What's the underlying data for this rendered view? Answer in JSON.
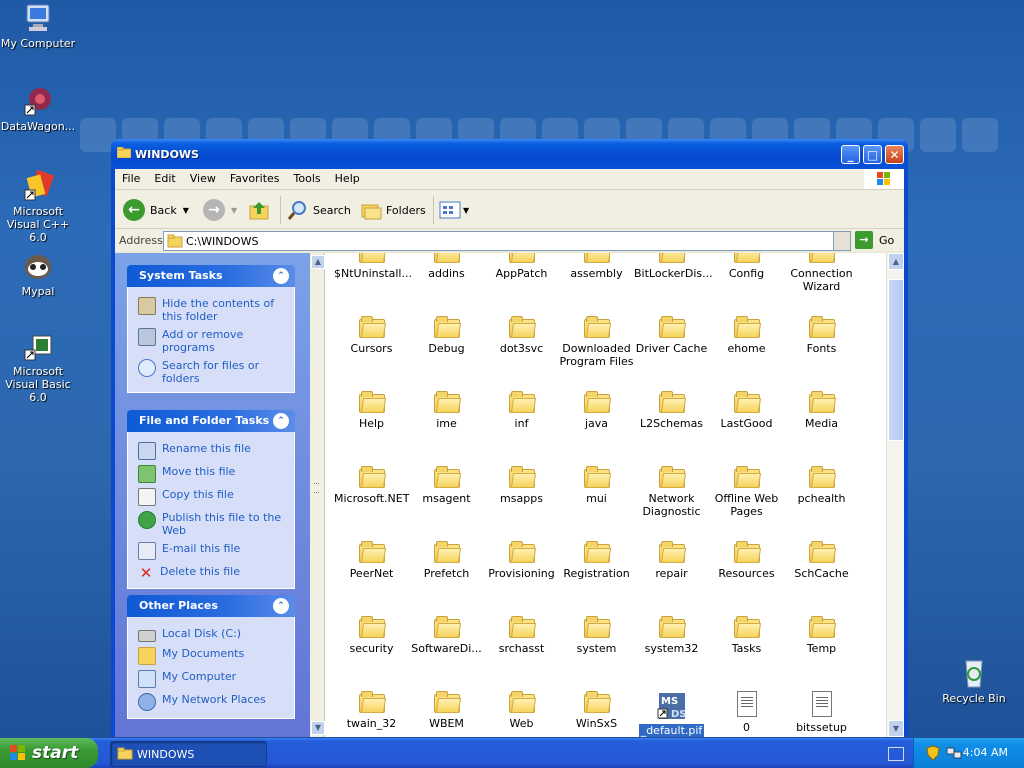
{
  "desktop": {
    "icons": [
      {
        "label": "My Computer",
        "icon": "my-computer-icon"
      },
      {
        "label": "DataWagon...",
        "icon": "datawagon-shortcut-icon"
      },
      {
        "label": "Microsoft Visual C++ 6.0",
        "icon": "visual-cpp-shortcut-icon"
      },
      {
        "label": "Mypal",
        "icon": "mypal-icon"
      },
      {
        "label": "Microsoft Visual Basic 6.0",
        "icon": "visual-basic-shortcut-icon"
      },
      {
        "label": "Recycle Bin",
        "icon": "recycle-bin-icon"
      }
    ]
  },
  "window": {
    "title": "WINDOWS",
    "menu": [
      "File",
      "Edit",
      "View",
      "Favorites",
      "Tools",
      "Help"
    ],
    "toolbar": {
      "back": "Back",
      "search": "Search",
      "folders": "Folders"
    },
    "address": {
      "label": "Address",
      "value": "C:\\WINDOWS",
      "go": "Go"
    }
  },
  "left_pane": {
    "system_tasks": {
      "title": "System Tasks",
      "items": [
        "Hide the contents of this folder",
        "Add or remove programs",
        "Search for files or folders"
      ]
    },
    "file_folder_tasks": {
      "title": "File and Folder Tasks",
      "items": [
        "Rename this file",
        "Move this file",
        "Copy this file",
        "Publish this file to the Web",
        "E-mail this file",
        "Delete this file"
      ]
    },
    "other_places": {
      "title": "Other Places",
      "items": [
        "Local Disk (C:)",
        "My Documents",
        "My Computer",
        "My Network Places"
      ]
    }
  },
  "files": [
    {
      "name": "$NtUninstall...",
      "type": "folder"
    },
    {
      "name": "addins",
      "type": "folder"
    },
    {
      "name": "AppPatch",
      "type": "folder"
    },
    {
      "name": "assembly",
      "type": "folder"
    },
    {
      "name": "BitLockerDis...",
      "type": "folder"
    },
    {
      "name": "Config",
      "type": "folder"
    },
    {
      "name": "Connection Wizard",
      "type": "folder"
    },
    {
      "name": "Cursors",
      "type": "folder"
    },
    {
      "name": "Debug",
      "type": "folder"
    },
    {
      "name": "dot3svc",
      "type": "folder"
    },
    {
      "name": "Downloaded Program Files",
      "type": "folder"
    },
    {
      "name": "Driver Cache",
      "type": "folder"
    },
    {
      "name": "ehome",
      "type": "folder"
    },
    {
      "name": "Fonts",
      "type": "folder"
    },
    {
      "name": "Help",
      "type": "folder"
    },
    {
      "name": "ime",
      "type": "folder"
    },
    {
      "name": "inf",
      "type": "folder"
    },
    {
      "name": "java",
      "type": "folder"
    },
    {
      "name": "L2Schemas",
      "type": "folder"
    },
    {
      "name": "LastGood",
      "type": "folder"
    },
    {
      "name": "Media",
      "type": "folder"
    },
    {
      "name": "Microsoft.NET",
      "type": "folder"
    },
    {
      "name": "msagent",
      "type": "folder"
    },
    {
      "name": "msapps",
      "type": "folder"
    },
    {
      "name": "mui",
      "type": "folder"
    },
    {
      "name": "Network Diagnostic",
      "type": "folder"
    },
    {
      "name": "Offline Web Pages",
      "type": "folder"
    },
    {
      "name": "pchealth",
      "type": "folder"
    },
    {
      "name": "PeerNet",
      "type": "folder"
    },
    {
      "name": "Prefetch",
      "type": "folder"
    },
    {
      "name": "Provisioning",
      "type": "folder"
    },
    {
      "name": "Registration",
      "type": "folder"
    },
    {
      "name": "repair",
      "type": "folder"
    },
    {
      "name": "Resources",
      "type": "folder"
    },
    {
      "name": "SchCache",
      "type": "folder"
    },
    {
      "name": "security",
      "type": "folder"
    },
    {
      "name": "SoftwareDi...",
      "type": "folder"
    },
    {
      "name": "srchasst",
      "type": "folder"
    },
    {
      "name": "system",
      "type": "folder"
    },
    {
      "name": "system32",
      "type": "folder"
    },
    {
      "name": "Tasks",
      "type": "folder"
    },
    {
      "name": "Temp",
      "type": "folder"
    },
    {
      "name": "twain_32",
      "type": "folder"
    },
    {
      "name": "WBEM",
      "type": "folder"
    },
    {
      "name": "Web",
      "type": "folder"
    },
    {
      "name": "WinSxS",
      "type": "folder"
    },
    {
      "name": "_default.pif",
      "type": "pif",
      "selected": true
    },
    {
      "name": "0",
      "type": "doc"
    },
    {
      "name": "bitssetup",
      "type": "doc"
    }
  ],
  "taskbar": {
    "start": "start",
    "task": "WINDOWS",
    "clock": "4:04 AM"
  }
}
